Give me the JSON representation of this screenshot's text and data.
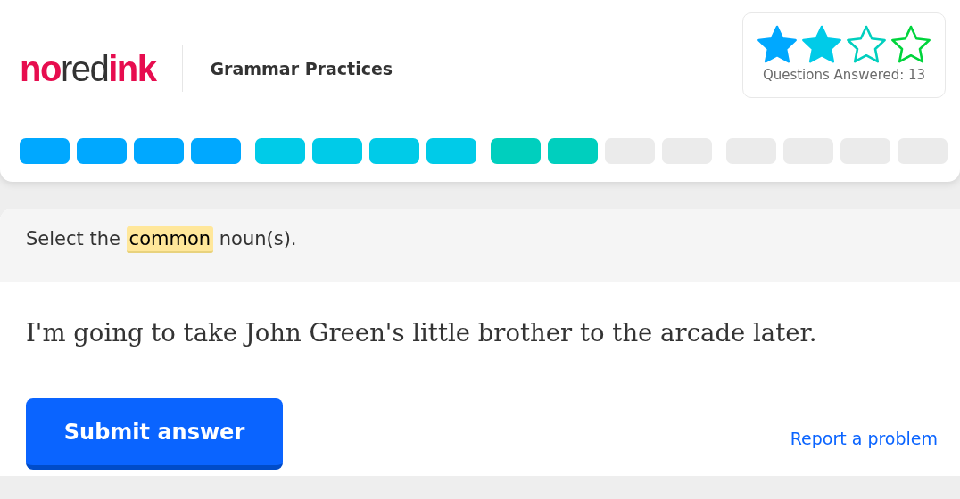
{
  "header": {
    "logo": [
      {
        "text": "no",
        "kind": "accent"
      },
      {
        "text": "red",
        "kind": "plain"
      },
      {
        "text": "ink",
        "kind": "accent"
      }
    ],
    "title": "Grammar Practices",
    "rating": {
      "stars": 2,
      "items": [
        {
          "color": "#00a8ff"
        },
        {
          "color": "#00cbe8"
        },
        {
          "color": "#00cfbe"
        },
        {
          "color": "#00d43c"
        }
      ],
      "label": "Questions Answered: 13"
    },
    "progress": [
      {
        "segments": [
          {
            "color": "#00a8ff"
          },
          {
            "color": "#00a8ff"
          },
          {
            "color": "#00a8ff"
          },
          {
            "color": "#00a8ff"
          }
        ]
      },
      {
        "segments": [
          {
            "color": "#00cbe8"
          },
          {
            "color": "#00cbe8"
          },
          {
            "color": "#00cbe8"
          },
          {
            "color": "#00cbe8"
          }
        ]
      },
      {
        "segments": [
          {
            "color": "#00cfbe"
          },
          {
            "color": "#00cfbe"
          },
          {
            "color": "#ebebeb"
          },
          {
            "color": "#ebebeb"
          }
        ]
      },
      {
        "segments": [
          {
            "color": "#ebebeb"
          },
          {
            "color": "#ebebeb"
          },
          {
            "color": "#ebebeb"
          },
          {
            "color": "#ebebeb"
          }
        ]
      }
    ]
  },
  "question": {
    "prompt": {
      "before": "Select the",
      "highlight": "common",
      "after": "noun(s)."
    },
    "sentence": "I'm going to take John Green's little brother to the arcade later.",
    "submit": "Submit answer",
    "report": "Report a problem"
  }
}
